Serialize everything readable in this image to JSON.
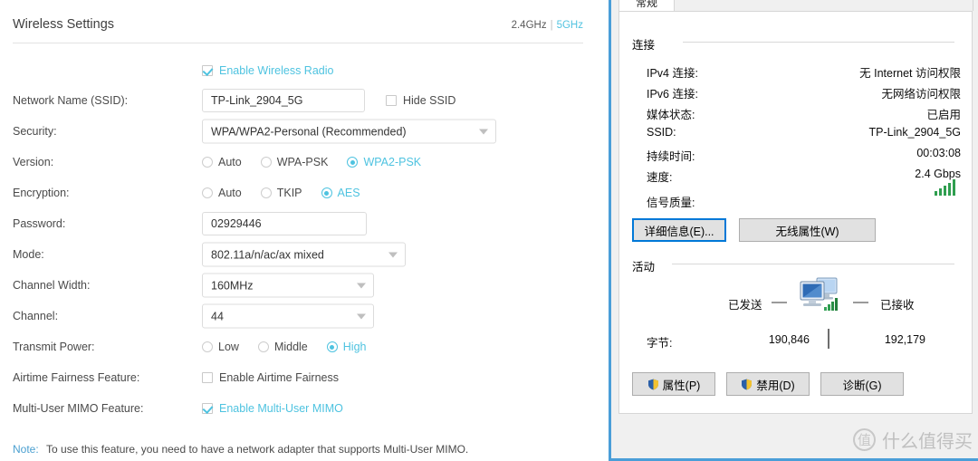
{
  "tplink": {
    "title": "Wireless Settings",
    "bands": {
      "b24": "2.4GHz",
      "separator": "|",
      "b5": "5GHz"
    },
    "enable_radio": {
      "label": "Enable Wireless Radio",
      "checked": true
    },
    "fields": {
      "ssid": {
        "label": "Network Name (SSID):",
        "value": "TP-Link_2904_5G"
      },
      "hide_ssid": {
        "label": "Hide SSID",
        "checked": false
      },
      "security": {
        "label": "Security:",
        "value": "WPA/WPA2-Personal (Recommended)"
      },
      "version": {
        "label": "Version:",
        "options": [
          "Auto",
          "WPA-PSK",
          "WPA2-PSK"
        ],
        "selected": "WPA2-PSK"
      },
      "encryption": {
        "label": "Encryption:",
        "options": [
          "Auto",
          "TKIP",
          "AES"
        ],
        "selected": "AES"
      },
      "password": {
        "label": "Password:",
        "value": "02929446"
      },
      "mode": {
        "label": "Mode:",
        "value": "802.11a/n/ac/ax mixed"
      },
      "channel_width": {
        "label": "Channel Width:",
        "value": "160MHz"
      },
      "channel": {
        "label": "Channel:",
        "value": "44"
      },
      "transmit_power": {
        "label": "Transmit Power:",
        "options": [
          "Low",
          "Middle",
          "High"
        ],
        "selected": "High"
      },
      "airtime": {
        "label": "Airtime Fairness Feature:",
        "checkbox_label": "Enable Airtime Fairness",
        "checked": false
      },
      "mumimo": {
        "label": "Multi-User MIMO Feature:",
        "checkbox_label": "Enable Multi-User MIMO",
        "checked": true
      }
    },
    "note": {
      "keyword": "Note:",
      "text": "To use this feature, you need to have a network adapter that supports Multi-User MIMO."
    },
    "accent_color": "#4ec3e0"
  },
  "windows_dialog": {
    "tab": "常规",
    "connection": {
      "group_title": "连接",
      "rows": [
        {
          "key": "IPv4 连接:",
          "value": "无 Internet 访问权限"
        },
        {
          "key": "IPv6 连接:",
          "value": "无网络访问权限"
        },
        {
          "key": "媒体状态:",
          "value": "已启用"
        },
        {
          "key": "SSID:",
          "value": "TP-Link_2904_5G"
        },
        {
          "key": "持续时间:",
          "value": "00:03:08"
        },
        {
          "key": "速度:",
          "value": "2.4 Gbps"
        }
      ],
      "signal_quality_label": "信号质量:",
      "signal_bars": 5,
      "buttons": [
        {
          "label": "详细信息(E)...",
          "focused": true
        },
        {
          "label": "无线属性(W)",
          "focused": false
        }
      ]
    },
    "activity": {
      "group_title": "活动",
      "sent_label": "已发送",
      "received_label": "已接收",
      "bytes_label": "字节:",
      "bytes_sent": "190,846",
      "bytes_received": "192,179"
    },
    "footer_buttons": [
      {
        "label": "属性(P)",
        "shield": true
      },
      {
        "label": "禁用(D)",
        "shield": true
      },
      {
        "label": "诊断(G)",
        "shield": false
      }
    ],
    "border_color": "#4a9ed8"
  },
  "watermark": {
    "mark": "值",
    "text": "什么值得买"
  }
}
